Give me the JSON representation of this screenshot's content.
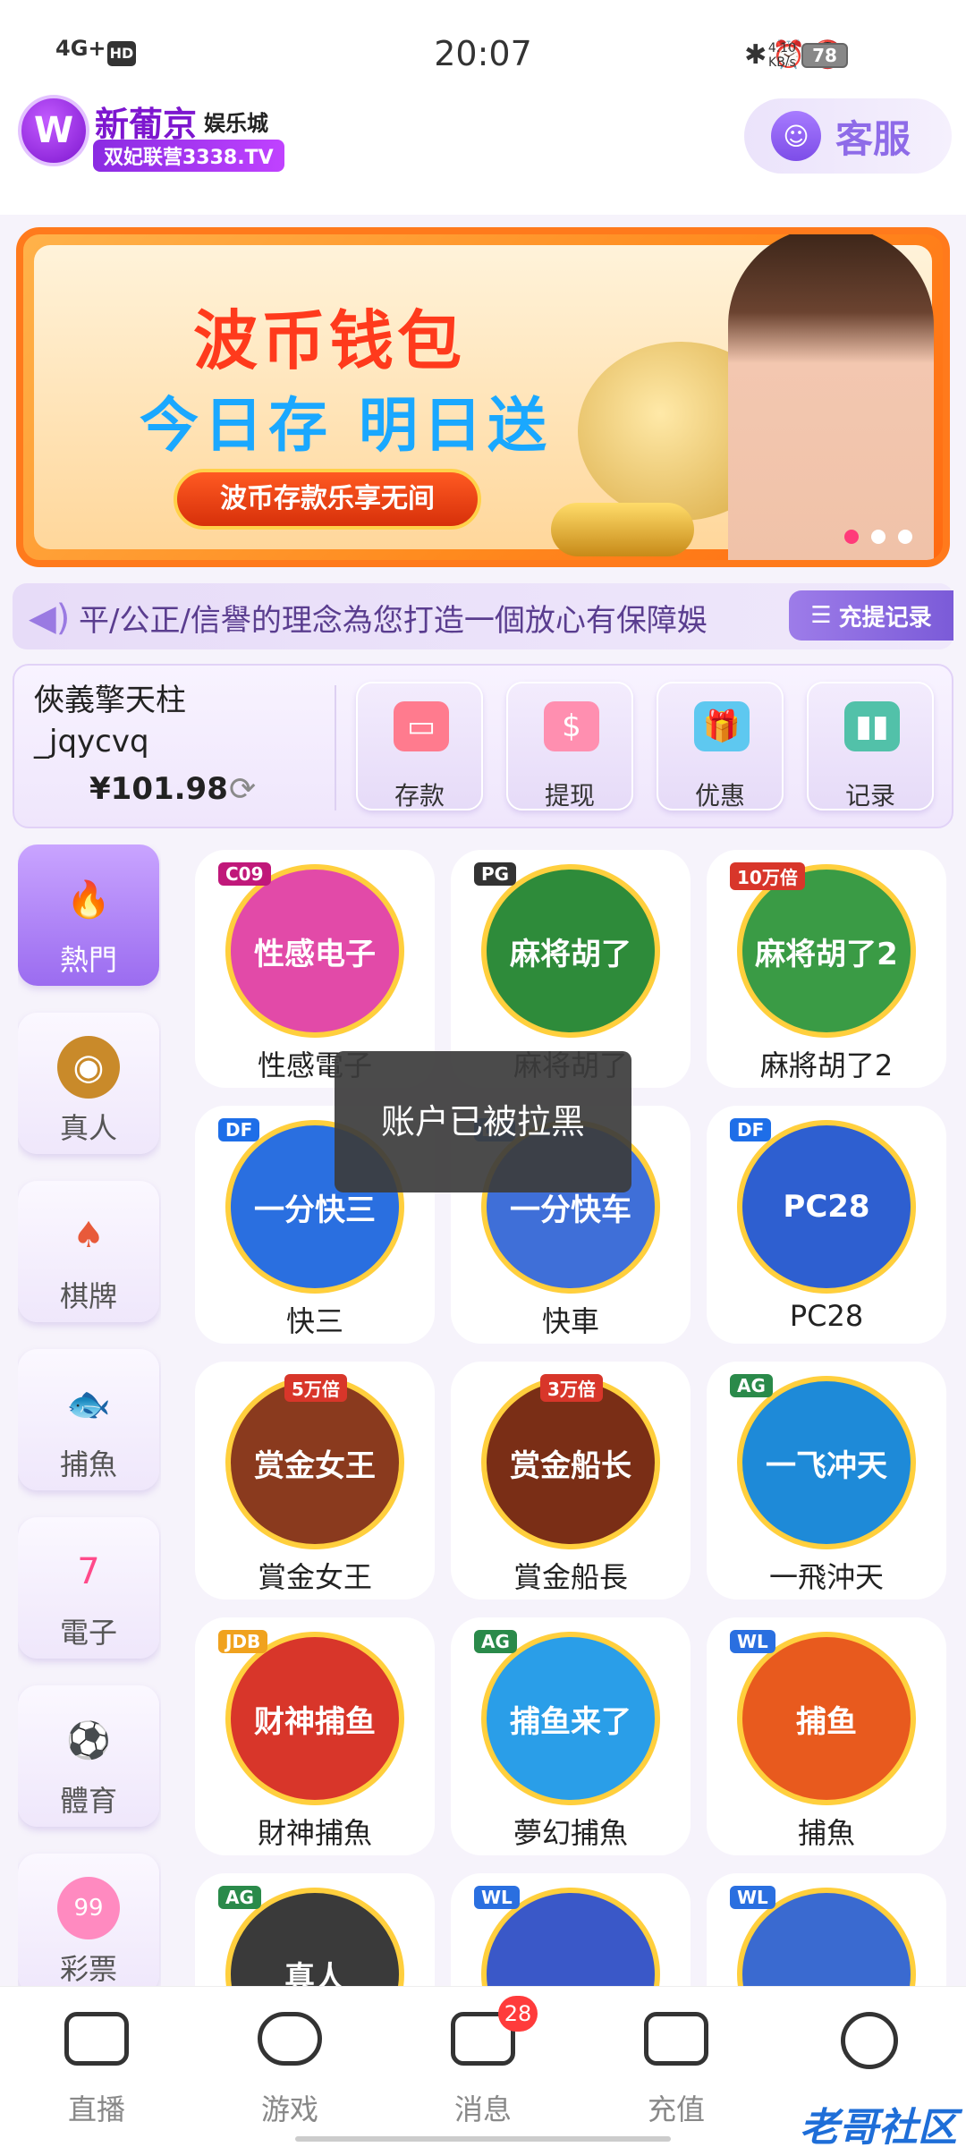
{
  "status_bar": {
    "network": "4G+",
    "hd_badge": "HD",
    "time": "20:07",
    "speed_value": "4.10",
    "speed_unit": "KB/s",
    "battery": "78"
  },
  "header": {
    "logo_name": "新葡京",
    "logo_suffix": "娱乐城",
    "logo_tagline": "双妃联营3338.TV",
    "service_label": "客服"
  },
  "banner": {
    "title": "波币钱包",
    "subtitle": "今日存 明日送",
    "button": "波币存款乐享无间",
    "active_slide": 1,
    "slide_count": 3
  },
  "marquee": {
    "text": "平/公正/信譽的理念為您打造一個放心有保障娛",
    "record_button": "充提记录"
  },
  "account": {
    "username_line1": "俠義擎天柱",
    "username_line2": "_jqycvq",
    "balance": "¥101.98",
    "actions": [
      {
        "label": "存款",
        "icon": "card-icon",
        "color": "#ff7b8e"
      },
      {
        "label": "提现",
        "icon": "money-bag-icon",
        "color": "#ff8fb0"
      },
      {
        "label": "优惠",
        "icon": "gift-icon",
        "color": "#5ec8f0"
      },
      {
        "label": "记录",
        "icon": "bar-chart-icon",
        "color": "#52c1a9"
      }
    ]
  },
  "categories": [
    {
      "label": "熱門",
      "icon": "flame-icon",
      "active": true
    },
    {
      "label": "真人",
      "icon": "chip-icon",
      "active": false
    },
    {
      "label": "棋牌",
      "icon": "card-icon",
      "active": false
    },
    {
      "label": "捕魚",
      "icon": "fish-icon",
      "active": false
    },
    {
      "label": "電子",
      "icon": "slot-icon",
      "active": false
    },
    {
      "label": "體育",
      "icon": "soccer-ball-icon",
      "active": false
    },
    {
      "label": "彩票",
      "icon": "lottery-ball-icon",
      "active": false
    }
  ],
  "games": [
    {
      "label": "性感電子",
      "art": "性感电子",
      "tag": "C09",
      "color": "#e24aa8"
    },
    {
      "label": "麻将胡了",
      "art": "麻将胡了",
      "tag": "PG",
      "color": "#2e8b3a"
    },
    {
      "label": "麻將胡了2",
      "art": "麻将胡了2",
      "tag": "10万倍",
      "color": "#3a9b45"
    },
    {
      "label": "快三",
      "art": "一分快三",
      "tag": "DF",
      "color": "#2a6fe0"
    },
    {
      "label": "快車",
      "art": "一分快车",
      "tag": "DF",
      "color": "#3f6fd8"
    },
    {
      "label": "PC28",
      "art": "PC28",
      "tag": "DF",
      "color": "#2e5fd0"
    },
    {
      "label": "賞金女王",
      "art": "赏金女王",
      "tag": "5万倍",
      "color": "#8a3a1e"
    },
    {
      "label": "賞金船長",
      "art": "赏金船长",
      "tag": "3万倍",
      "color": "#7a2e16"
    },
    {
      "label": "一飛沖天",
      "art": "一飞冲天",
      "tag": "AG",
      "color": "#1e8ad8"
    },
    {
      "label": "財神捕魚",
      "art": "财神捕鱼",
      "tag": "JDB",
      "color": "#d8362a"
    },
    {
      "label": "夢幻捕魚",
      "art": "捕鱼来了",
      "tag": "AG",
      "color": "#2a9ee8"
    },
    {
      "label": "捕魚",
      "art": "捕鱼",
      "tag": "WL",
      "color": "#e85a1e"
    },
    {
      "label": "",
      "art": "真人",
      "tag": "AG",
      "color": "#3a3a3a"
    },
    {
      "label": "",
      "art": "",
      "tag": "WL",
      "color": "#3a58c8"
    },
    {
      "label": "",
      "art": "",
      "tag": "WL",
      "color": "#3a6ad0"
    }
  ],
  "toast": "账户已被拉黑",
  "bottom_nav": [
    {
      "label": "直播",
      "icon": "video-camera-icon"
    },
    {
      "label": "游戏",
      "icon": "gamepad-icon"
    },
    {
      "label": "消息",
      "icon": "message-icon",
      "badge": "28"
    },
    {
      "label": "充值",
      "icon": "wallet-icon"
    },
    {
      "label": "",
      "icon": "smile-icon"
    }
  ],
  "watermark": "老哥社区"
}
